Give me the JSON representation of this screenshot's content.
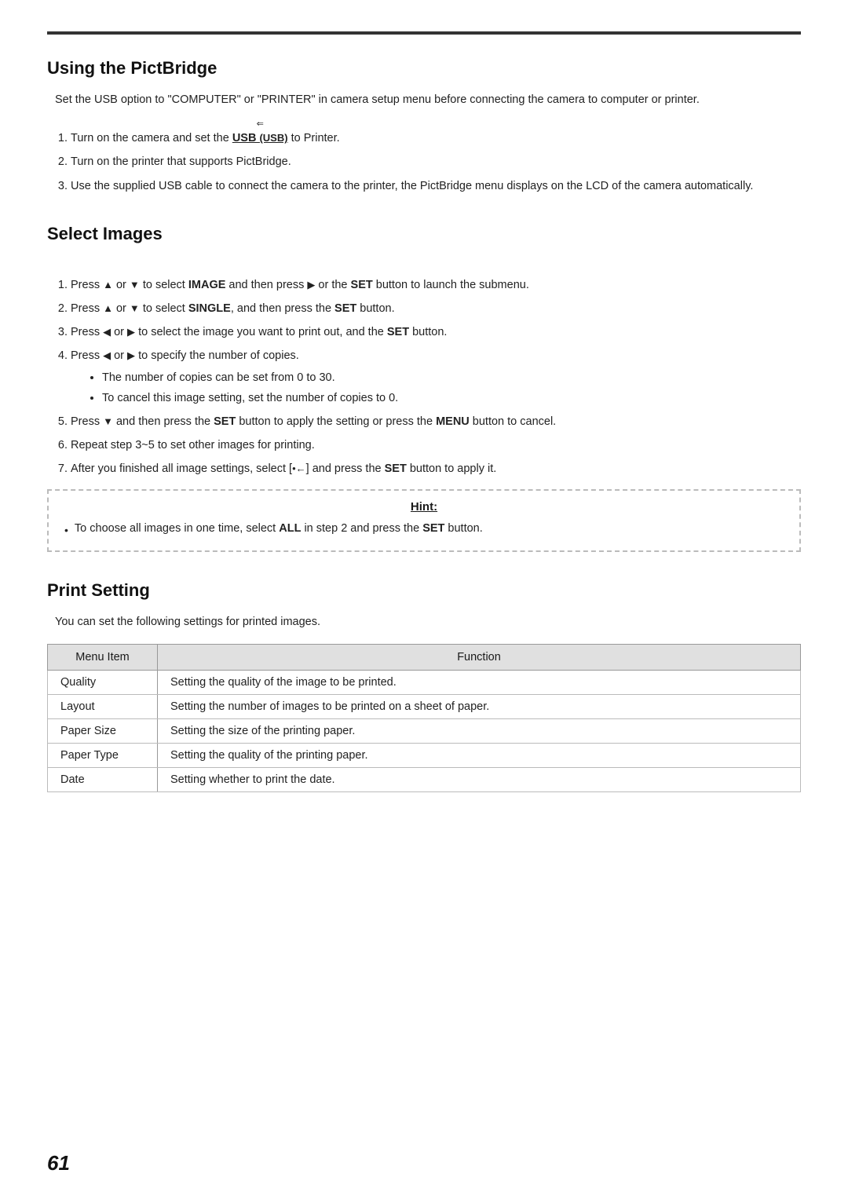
{
  "page": {
    "number": "61",
    "top_border": true
  },
  "section_pictbridge": {
    "title": "Using the PictBridge",
    "intro": "Set the USB option to \"COMPUTER\" or \"PRINTER\" in camera setup menu before connecting the camera to computer or printer.",
    "steps": [
      {
        "id": 1,
        "text_before": "Turn on the camera and set the",
        "usb_label": "USB",
        "usb_sub": "(USB)",
        "text_after": "to Printer."
      },
      {
        "id": 2,
        "text": "Turn on the printer that supports PictBridge."
      },
      {
        "id": 3,
        "text": "Use the supplied USB cable to connect the camera to the printer, the PictBridge menu displays on the LCD of the camera automatically."
      }
    ]
  },
  "section_select_images": {
    "title": "Select Images",
    "steps": [
      {
        "id": 1,
        "text": "Press ▲ or ▼ to select IMAGE and then press ▶ or the SET button to launch the submenu.",
        "bold_words": [
          "IMAGE",
          "SET"
        ]
      },
      {
        "id": 2,
        "text": "Press ▲ or ▼ to select SINGLE, and then press the SET button.",
        "bold_words": [
          "SINGLE",
          "SET"
        ]
      },
      {
        "id": 3,
        "text": "Press ◀ or ▶ to select the image you want to print out, and the SET button.",
        "bold_words": [
          "SET"
        ]
      },
      {
        "id": 4,
        "text": "Press ◀ or ▶ to specify the number of copies.",
        "bullets": [
          "The number of copies can be set from 0 to 30.",
          "To cancel this image setting, set the number of copies to 0."
        ]
      },
      {
        "id": 5,
        "text": "Press ▼ and then press the SET button to apply the setting or press the MENU button to cancel.",
        "bold_words": [
          "SET",
          "MENU"
        ]
      },
      {
        "id": 6,
        "text": "Repeat step 3~5 to set other images for printing."
      },
      {
        "id": 7,
        "text": "After you finished all image settings, select [",
        "symbol": "↵",
        "text_after": "] and press the SET button to apply it.",
        "bold_words": [
          "SET"
        ]
      }
    ],
    "hint": {
      "title": "Hint:",
      "text": "To choose all images in one time, select ALL in step 2 and press the SET button.",
      "bold_words": [
        "ALL",
        "SET"
      ]
    }
  },
  "section_print_setting": {
    "title": "Print Setting",
    "intro": "You can set the following settings for printed images.",
    "table": {
      "headers": [
        "Menu Item",
        "Function"
      ],
      "rows": [
        [
          "Quality",
          "Setting the quality of the image to be printed."
        ],
        [
          "Layout",
          "Setting the number of images to be printed on a sheet of paper."
        ],
        [
          "Paper Size",
          "Setting the size of the printing paper."
        ],
        [
          "Paper Type",
          "Setting the quality of the printing paper."
        ],
        [
          "Date",
          "Setting whether to print the date."
        ]
      ]
    }
  }
}
